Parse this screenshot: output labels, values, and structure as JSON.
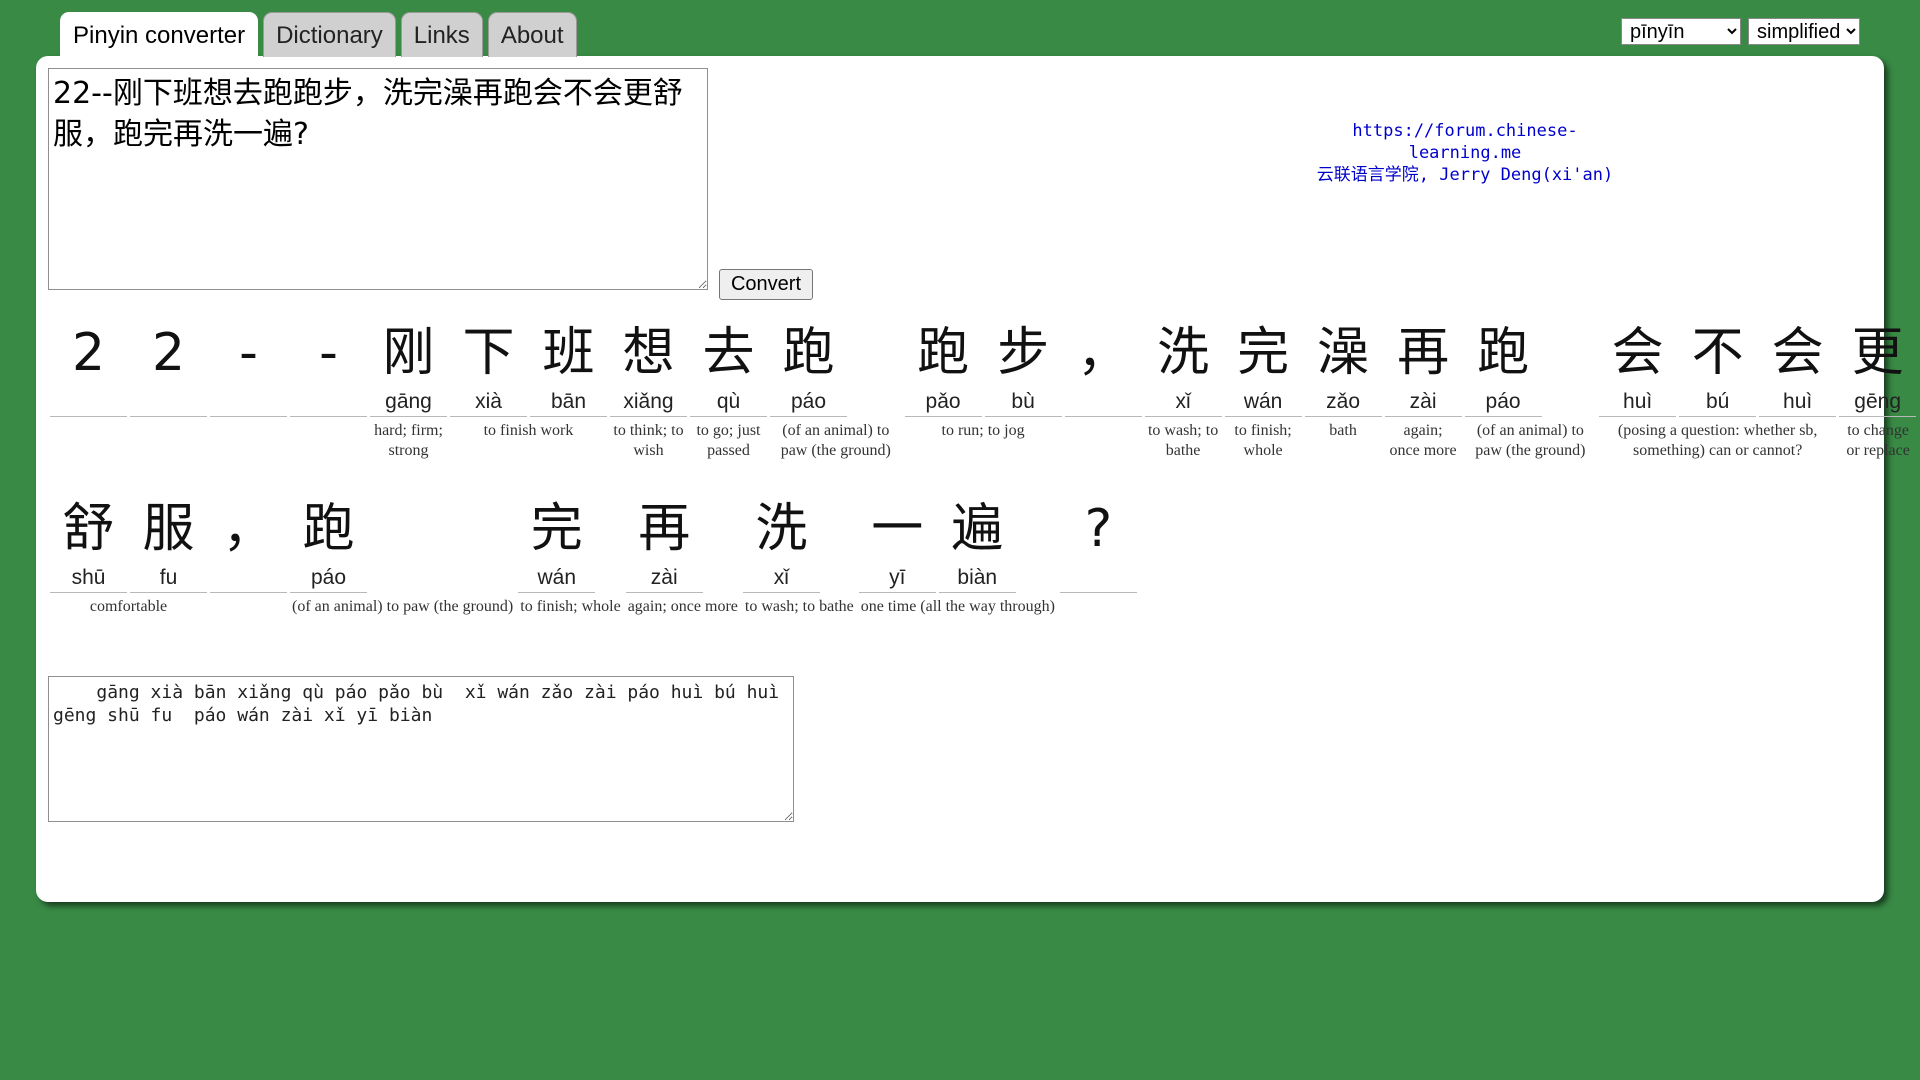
{
  "tabs": [
    "Pinyin converter",
    "Dictionary",
    "Links",
    "About"
  ],
  "selects": {
    "script": "pīnyīn",
    "charset": "simplified"
  },
  "input_text": "22--刚下班想去跑跑步，洗完澡再跑会不会更舒服，跑完再洗一遍?",
  "convert_label": "Convert",
  "credits": {
    "url": "https://forum.chinese-learning.me",
    "line2": "云联语言学院, Jerry Deng(xi'an)"
  },
  "rows": [
    [
      {
        "chars": [
          {
            "hz": "2",
            "py": ""
          }
        ],
        "def": ""
      },
      {
        "chars": [
          {
            "hz": "2",
            "py": ""
          }
        ],
        "def": ""
      },
      {
        "chars": [
          {
            "hz": "-",
            "py": ""
          }
        ],
        "def": ""
      },
      {
        "chars": [
          {
            "hz": "-",
            "py": ""
          }
        ],
        "def": ""
      },
      {
        "chars": [
          {
            "hz": "刚",
            "py": "gāng"
          }
        ],
        "def": "hard; firm; strong"
      },
      {
        "chars": [
          {
            "hz": "下",
            "py": "xià"
          },
          {
            "hz": "班",
            "py": "bān"
          }
        ],
        "def": "to finish work"
      },
      {
        "chars": [
          {
            "hz": "想",
            "py": "xiǎng"
          }
        ],
        "def": "to think; to wish"
      },
      {
        "chars": [
          {
            "hz": "去",
            "py": "qù"
          }
        ],
        "def": "to go; just passed"
      },
      {
        "chars": [
          {
            "hz": "跑",
            "py": "páo"
          }
        ],
        "def": "(of an animal) to paw (the ground)"
      },
      {
        "chars": [
          {
            "hz": "跑",
            "py": "pǎo"
          },
          {
            "hz": "步",
            "py": "bù"
          }
        ],
        "def": "to run; to jog"
      },
      {
        "chars": [
          {
            "hz": "，",
            "py": ""
          }
        ],
        "def": ""
      },
      {
        "chars": [
          {
            "hz": "洗",
            "py": "xǐ"
          }
        ],
        "def": "to wash; to bathe"
      },
      {
        "chars": [
          {
            "hz": "完",
            "py": "wán"
          }
        ],
        "def": "to finish; whole"
      },
      {
        "chars": [
          {
            "hz": "澡",
            "py": "zǎo"
          }
        ],
        "def": "bath"
      },
      {
        "chars": [
          {
            "hz": "再",
            "py": "zài"
          }
        ],
        "def": "again; once more"
      },
      {
        "chars": [
          {
            "hz": "跑",
            "py": "páo"
          }
        ],
        "def": "(of an animal) to paw (the ground)"
      },
      {
        "chars": [
          {
            "hz": "会",
            "py": "huì"
          },
          {
            "hz": "不",
            "py": "bú"
          },
          {
            "hz": "会",
            "py": "huì"
          }
        ],
        "def": "(posing a question: whether sb, something) can or cannot?"
      },
      {
        "chars": [
          {
            "hz": "更",
            "py": "gēng"
          }
        ],
        "def": "to change or replace"
      }
    ],
    [
      {
        "chars": [
          {
            "hz": "舒",
            "py": "shū"
          },
          {
            "hz": "服",
            "py": "fu"
          }
        ],
        "def": "comfortable"
      },
      {
        "chars": [
          {
            "hz": "，",
            "py": ""
          }
        ],
        "def": ""
      },
      {
        "chars": [
          {
            "hz": "跑",
            "py": "páo"
          }
        ],
        "def": "(of an animal) to paw (the ground)"
      },
      {
        "chars": [
          {
            "hz": "完",
            "py": "wán"
          }
        ],
        "def": "to finish; whole"
      },
      {
        "chars": [
          {
            "hz": "再",
            "py": "zài"
          }
        ],
        "def": "again; once more"
      },
      {
        "chars": [
          {
            "hz": "洗",
            "py": "xǐ"
          }
        ],
        "def": "to wash; to bathe"
      },
      {
        "chars": [
          {
            "hz": "一",
            "py": "yī"
          },
          {
            "hz": "遍",
            "py": "biàn"
          }
        ],
        "def": "one time (all the way through)"
      },
      {
        "chars": [
          {
            "hz": "?",
            "py": ""
          }
        ],
        "def": ""
      }
    ]
  ],
  "output_text": "    gāng xià bān xiǎng qù páo pǎo bù  xǐ wán zǎo zài páo huì bú huì gēng shū fu  páo wán zài xǐ yī biàn"
}
